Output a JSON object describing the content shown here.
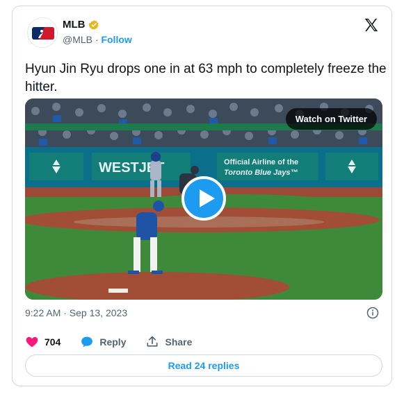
{
  "author": {
    "name": "MLB",
    "handle": "@MLB",
    "separator": "·",
    "follow_label": "Follow",
    "verified_color": "#e8b71c"
  },
  "tweet": {
    "text": "Hyun Jin Ryu drops one in at 63 mph to completely freeze the hitter.",
    "timestamp": "9:22 AM · Sep 13, 2023"
  },
  "media": {
    "watch_label": "Watch on Twitter",
    "banner_left": "WESTJET",
    "banner_right_line1": "Official Airline of the",
    "banner_right_line2": "Toronto Blue Jays™"
  },
  "actions": {
    "likes_count": "704",
    "reply_label": "Reply",
    "share_label": "Share",
    "read_replies_label": "Read 24 replies"
  },
  "colors": {
    "accent": "#1d9bf0",
    "like": "#f91880",
    "text": "#0f1419",
    "muted": "#536471"
  }
}
